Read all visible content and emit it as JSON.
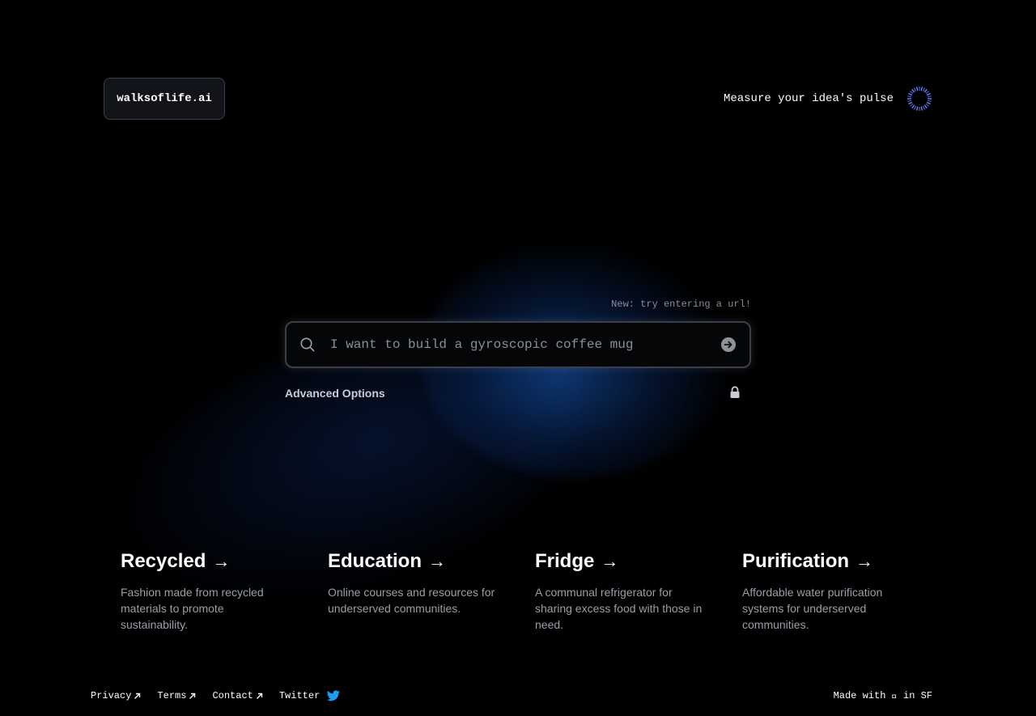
{
  "header": {
    "logo": "walksoflife.ai",
    "tagline": "Measure your idea's pulse"
  },
  "search": {
    "hint": "New: try entering a url!",
    "placeholder": "I want to build a gyroscopic coffee mug",
    "advanced_label": "Advanced Options"
  },
  "cards": [
    {
      "title": "Recycled",
      "description": "Fashion made from recycled materials to promote sustainability."
    },
    {
      "title": "Education",
      "description": "Online courses and resources for underserved communities."
    },
    {
      "title": "Fridge",
      "description": "A communal refrigerator for sharing excess food with those in need."
    },
    {
      "title": "Purification",
      "description": "Affordable water purification systems for underserved communities."
    }
  ],
  "footer": {
    "links": [
      "Privacy",
      "Terms",
      "Contact",
      "Twitter"
    ],
    "credit": "Made with \u0000 in SF"
  },
  "icons": {
    "spinner": "spinner-icon",
    "search": "search-icon",
    "submit": "arrow-right-circle-icon",
    "lock": "lock-icon",
    "external": "arrow-up-right-icon",
    "twitter": "twitter-bird-icon"
  },
  "colors": {
    "background": "#000000",
    "accent_blue": "#1d4ed8",
    "twitter_blue": "#1d9bf0",
    "muted_text": "#9a9ea8"
  }
}
